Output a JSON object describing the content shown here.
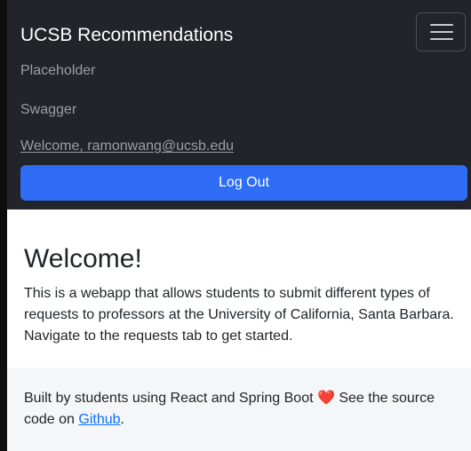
{
  "navbar": {
    "brand": "UCSB Recommendations",
    "links": [
      {
        "label": "Placeholder"
      },
      {
        "label": "Swagger"
      }
    ],
    "welcome": "Welcome, ramonwang@ucsb.edu",
    "logout_label": "Log Out"
  },
  "main": {
    "title": "Welcome!",
    "intro": "This is a webapp that allows students to submit different types of requests to professors at the University of California, Santa Barbara. Navigate to the requests tab to get started."
  },
  "footer": {
    "text_before": "Built by students using React and Spring Boot",
    "heart": "❤️",
    "text_after": " See the source code on ",
    "link_label": "Github",
    "period": "."
  },
  "colors": {
    "navbar_bg": "#212529",
    "button_primary": "#2f6df6",
    "link": "#0d6efd",
    "footer_bg": "#f5f6f8"
  },
  "icons": {
    "toggler": "hamburger-menu-icon",
    "heart": "heart-icon"
  }
}
